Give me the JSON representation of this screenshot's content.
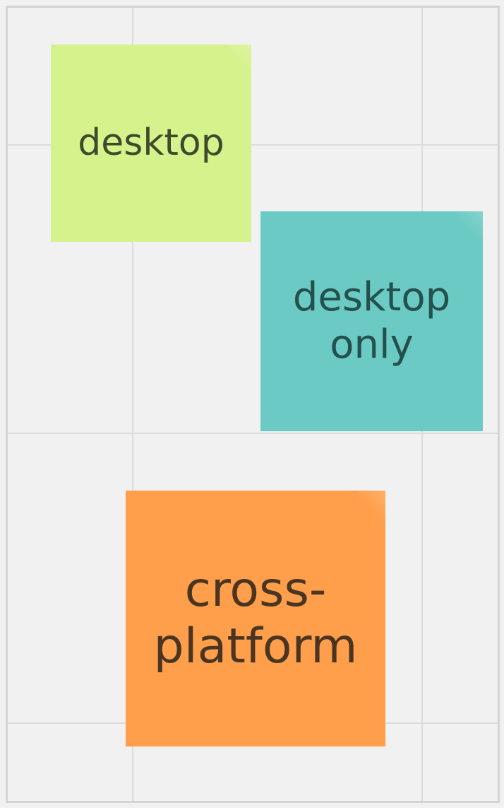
{
  "board": {
    "notes": [
      {
        "text": "desktop",
        "color": "#d5f28c"
      },
      {
        "text": "desktop\nonly",
        "color": "#6bcac3"
      },
      {
        "text": "cross-\nplatform",
        "color": "#ff9f4b"
      }
    ]
  }
}
